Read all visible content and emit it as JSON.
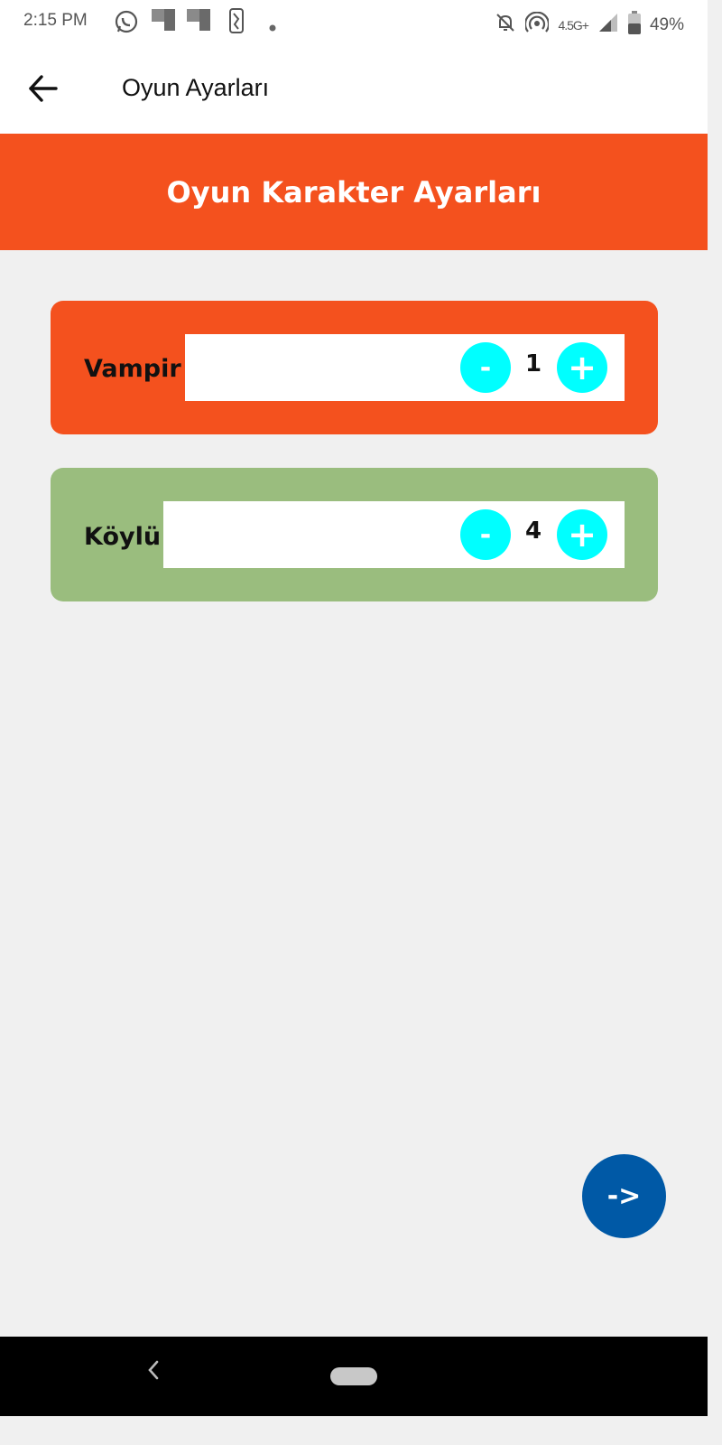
{
  "status_bar": {
    "time": "2:15 PM",
    "network": "4.5G+",
    "battery": "49%",
    "icons": [
      "whatsapp-icon",
      "notification-icon",
      "notification-icon",
      "nba-icon",
      "dot-icon",
      "mute-icon",
      "hotspot-icon",
      "signal-icon",
      "battery-icon"
    ]
  },
  "app_bar": {
    "title": "Oyun Ayarları",
    "back_icon": "arrow-left-icon"
  },
  "banner": {
    "title": "Oyun Karakter Ayarları"
  },
  "characters": [
    {
      "label": "Vampir",
      "count": "1",
      "minus": "-",
      "plus": "+"
    },
    {
      "label": "Köylü",
      "count": "4",
      "minus": "-",
      "plus": "+"
    }
  ],
  "fab": {
    "label": "->"
  },
  "colors": {
    "accent": "#f4511e",
    "card_green": "#9abd7e",
    "stepper_button": "#00ffff",
    "fab": "#0059a6",
    "background": "#f0f0f0"
  },
  "nav_bar": {
    "back_icon": "nav-back-icon",
    "home_icon": "nav-home-pill"
  }
}
